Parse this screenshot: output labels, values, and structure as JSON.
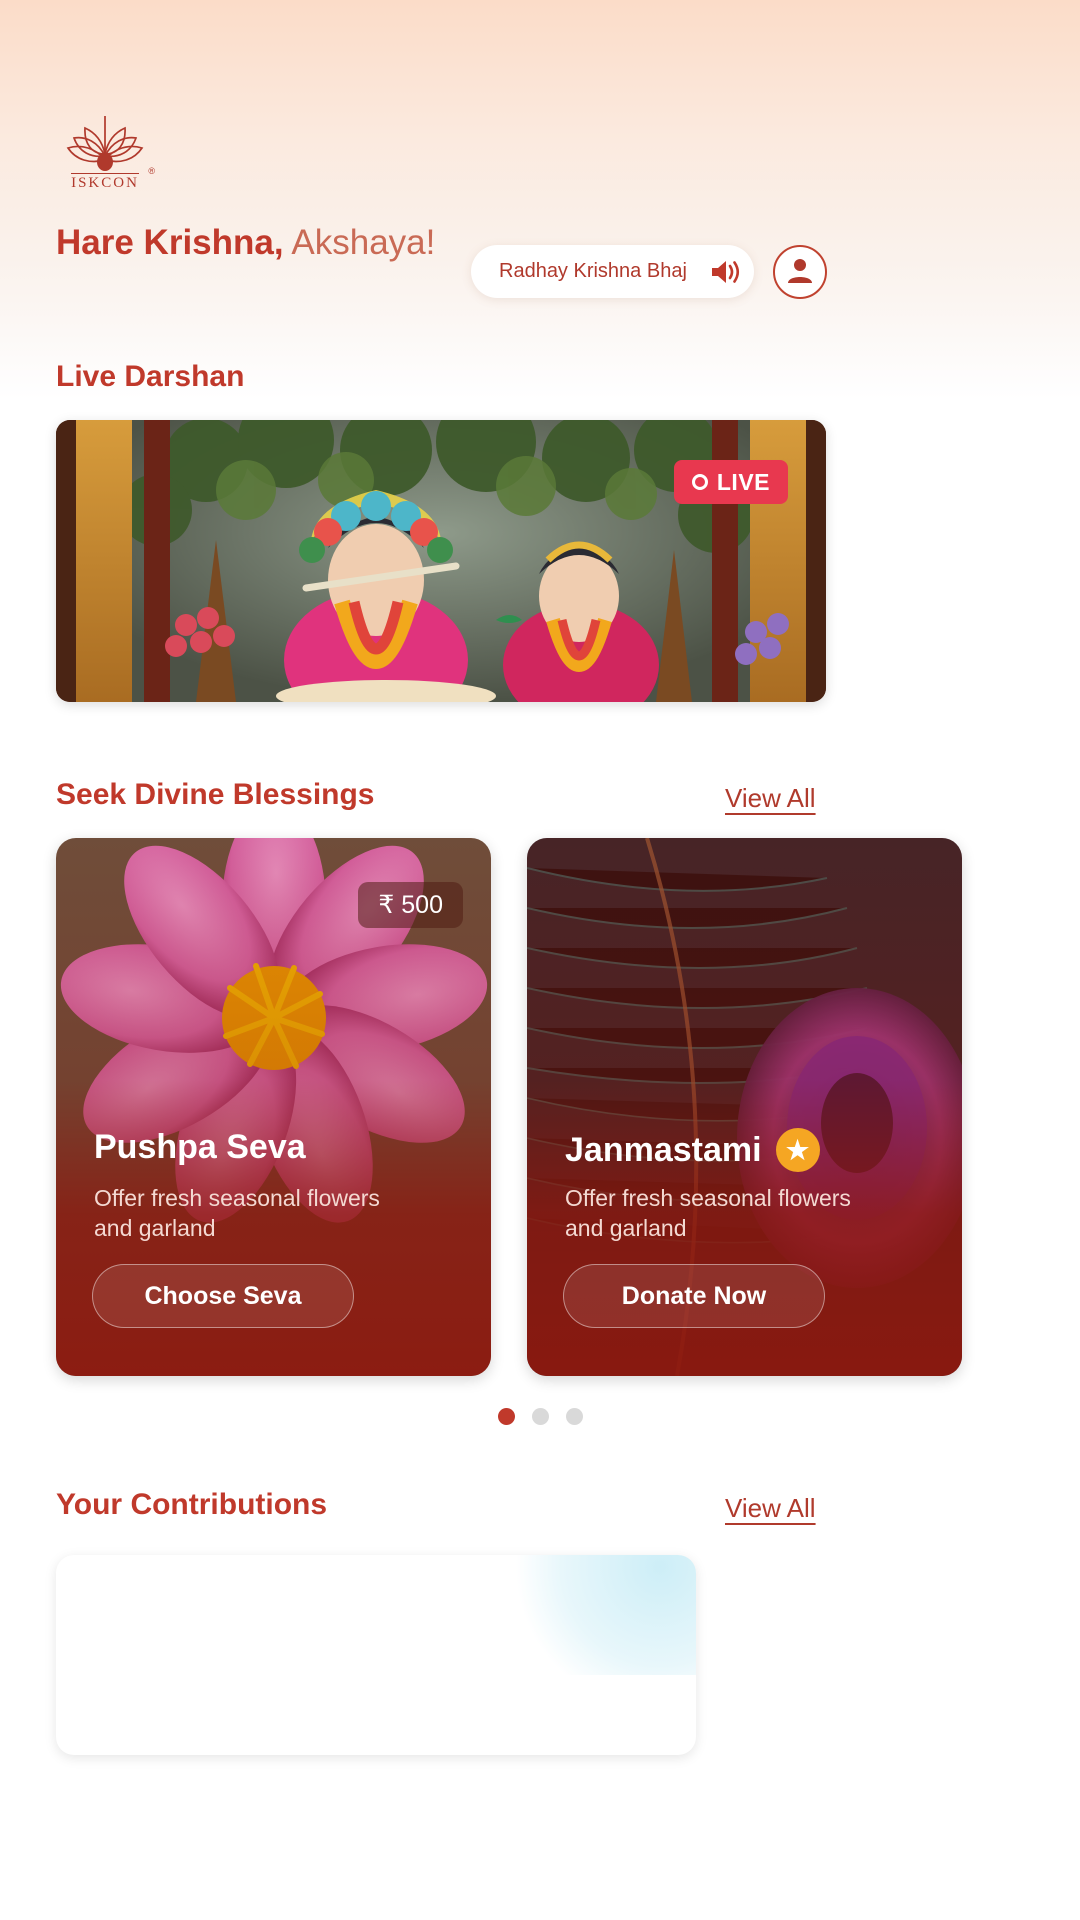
{
  "brand": {
    "name": "ISKCON",
    "registered": "®",
    "logo_icon": "lotus-icon"
  },
  "header": {
    "audio_player": {
      "track_title": "Radhay Krishna Bhaj",
      "speaker_icon": "speaker-volume-icon"
    },
    "profile": {
      "icon": "user-avatar-icon"
    }
  },
  "greeting": {
    "bold": "Hare Krishna,",
    "name": "Akshaya!"
  },
  "live_darshan": {
    "title": "Live Darshan",
    "badge": {
      "label": "LIVE",
      "icon": "record-dot-icon"
    }
  },
  "blessings": {
    "title": "Seek Divine Blessings",
    "view_all": "View All",
    "cards": [
      {
        "price": "₹ 500",
        "title": "Pushpa Seva",
        "description": "Offer fresh seasonal flowers and garland",
        "button": "Choose Seva",
        "badge_icon": ""
      },
      {
        "price": "",
        "title": "Janmastami",
        "description": "Offer fresh seasonal flowers and garland",
        "button": "Donate Now",
        "badge_icon": "star-icon"
      }
    ],
    "carousel": {
      "count": 3,
      "active": 0
    }
  },
  "contributions": {
    "title": "Your Contributions",
    "view_all": "View All"
  },
  "colors": {
    "brand_red": "#c0392b",
    "deep_red": "#b0392c",
    "live_red": "#e8384f",
    "star_amber": "#f5a623",
    "dot_inactive": "#d9d9d9"
  }
}
